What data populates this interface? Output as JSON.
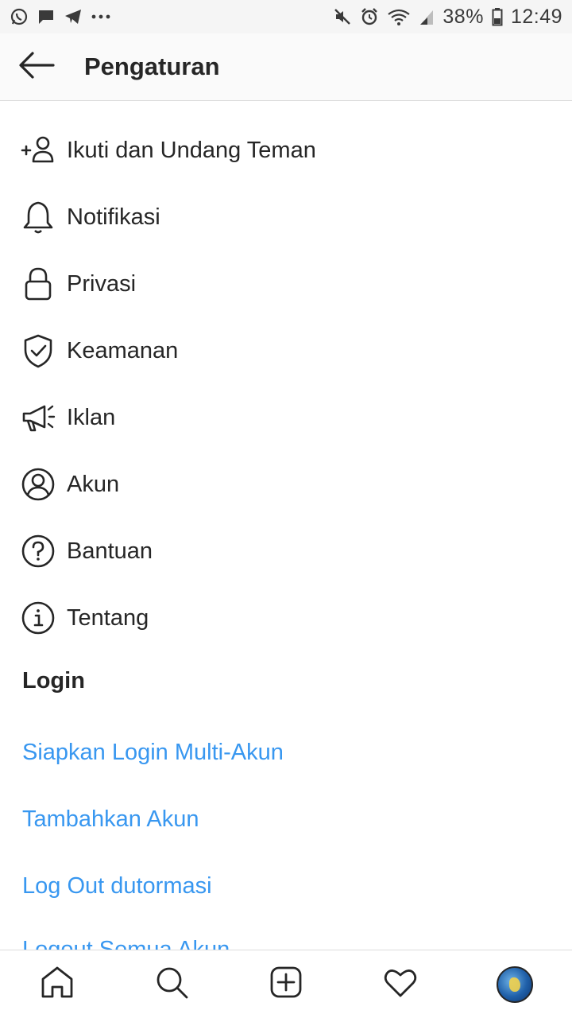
{
  "status_bar": {
    "battery": "38%",
    "time": "12:49"
  },
  "header": {
    "title": "Pengaturan"
  },
  "menu": {
    "items": [
      {
        "label": "Ikuti dan Undang Teman",
        "icon": "add-person-icon"
      },
      {
        "label": "Notifikasi",
        "icon": "bell-icon"
      },
      {
        "label": "Privasi",
        "icon": "lock-icon"
      },
      {
        "label": "Keamanan",
        "icon": "shield-check-icon"
      },
      {
        "label": "Iklan",
        "icon": "megaphone-icon"
      },
      {
        "label": "Akun",
        "icon": "account-circle-icon"
      },
      {
        "label": "Bantuan",
        "icon": "help-circle-icon"
      },
      {
        "label": "Tentang",
        "icon": "info-circle-icon"
      }
    ]
  },
  "login_section": {
    "title": "Login",
    "items": [
      "Siapkan Login Multi-Akun",
      "Tambahkan Akun",
      "Log Out dutormasi",
      "Logout Semua Akun"
    ]
  },
  "colors": {
    "link": "#3897f0",
    "text": "#262626",
    "divider": "#dbdbdb"
  }
}
